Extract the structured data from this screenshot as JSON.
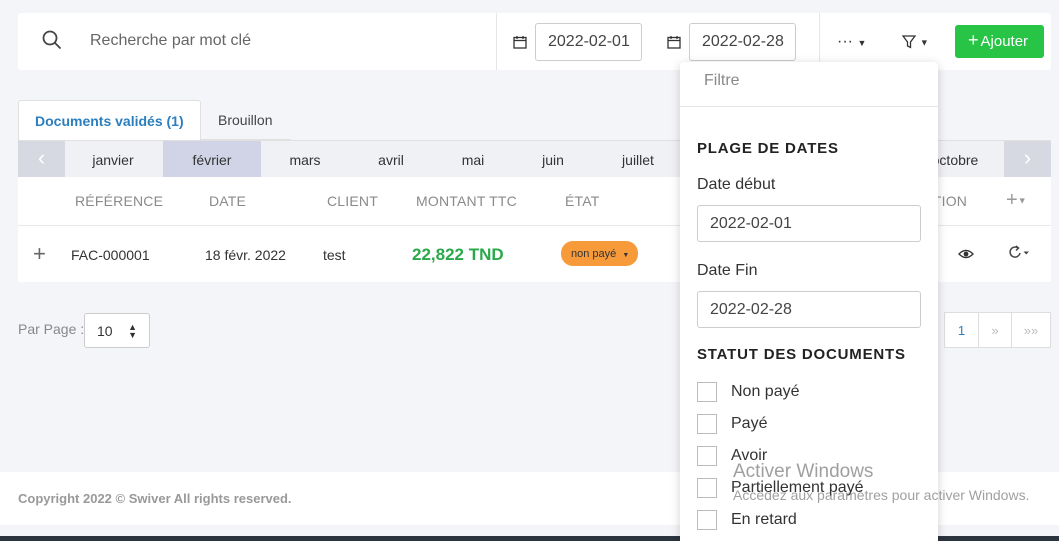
{
  "search": {
    "placeholder": "Recherche par mot clé"
  },
  "date_range": {
    "start": "2022-02-01",
    "end": "2022-02-28"
  },
  "toolbar": {
    "more_label": "···",
    "add_label": "Ajouter"
  },
  "tabs": [
    {
      "label": "Documents validés (1)",
      "active": true
    },
    {
      "label": "Brouillon",
      "active": false
    }
  ],
  "months": [
    "janvier",
    "février",
    "mars",
    "avril",
    "mai",
    "juin",
    "juillet",
    "octobre"
  ],
  "selected_month": "février",
  "table": {
    "headers": [
      "RÉFÉRENCE",
      "DATE",
      "CLIENT",
      "MONTANT TTC",
      "ÉTAT",
      "ACTION"
    ],
    "rows": [
      {
        "reference": "FAC-000001",
        "date": "18 févr. 2022",
        "client": "test",
        "amount": "22,822 TND",
        "status": "non payé"
      }
    ]
  },
  "pagination": {
    "per_page_label": "Par Page :",
    "per_page_value": "10",
    "current": "1",
    "next": "»",
    "last": "»»"
  },
  "footer": {
    "text": "Copyright 2022 © Swiver All rights reserved."
  },
  "filter_panel": {
    "title": "Filtre",
    "date_section": "PLAGE DE DATES",
    "start_label": "Date début",
    "start_value": "2022-02-01",
    "end_label": "Date Fin",
    "end_value": "2022-02-28",
    "status_section": "STATUT DES DOCUMENTS",
    "statuses": [
      "Non payé",
      "Payé",
      "Avoir",
      "Partiellement payé",
      "En retard"
    ]
  },
  "watermark": {
    "line1": "Activer Windows",
    "line2": "Accédez aux paramètres pour activer Windows."
  },
  "colors": {
    "accent": "#2b7fbf",
    "add_button": "#28c445",
    "amount": "#2aa84a",
    "badge": "#f69a3a"
  }
}
